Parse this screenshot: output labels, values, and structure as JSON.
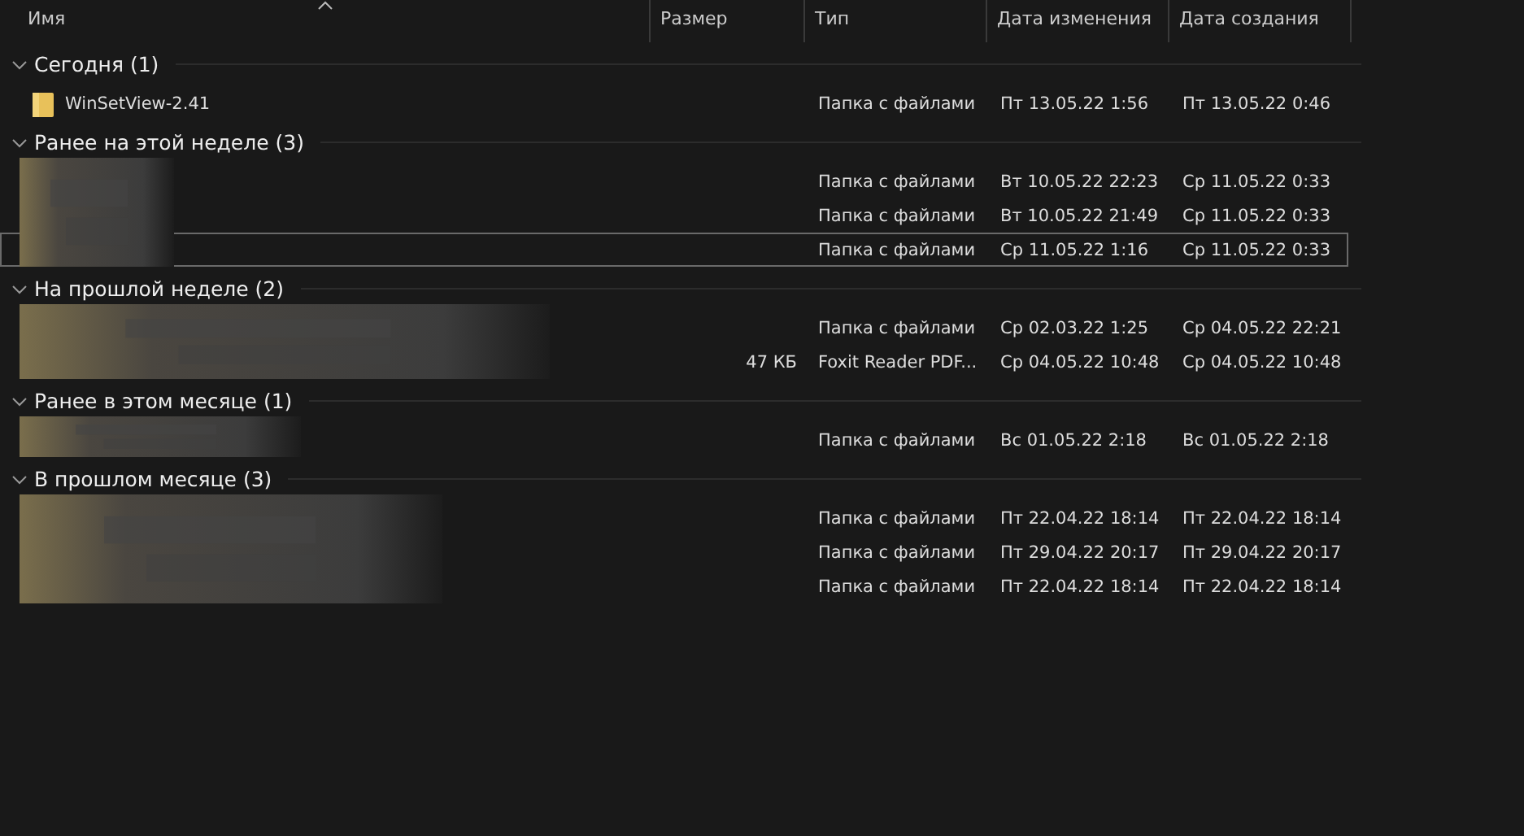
{
  "columns": [
    {
      "label": "Имя",
      "sorted": true
    },
    {
      "label": "Размер",
      "sorted": false
    },
    {
      "label": "Тип",
      "sorted": false
    },
    {
      "label": "Дата изменения",
      "sorted": false
    },
    {
      "label": "Дата создания",
      "sorted": false
    }
  ],
  "groups": [
    {
      "title": "Сегодня (1)",
      "expanded": true,
      "rows": [
        {
          "name": "WinSetView-2.41",
          "type": "Папка с файлами",
          "modified": "Пт 13.05.22 1:56",
          "created": "Пт 13.05.22 0:46",
          "selected": false
        }
      ]
    },
    {
      "title": "Ранее на этой неделе (3)",
      "expanded": true,
      "rows": [
        {
          "type": "Папка с файлами",
          "modified": "Вт 10.05.22 22:23",
          "created": "Ср 11.05.22 0:33",
          "selected": false
        },
        {
          "type": "Папка с файлами",
          "modified": "Вт 10.05.22 21:49",
          "created": "Ср 11.05.22 0:33",
          "selected": false
        },
        {
          "type": "Папка с файлами",
          "modified": "Ср 11.05.22 1:16",
          "created": "Ср 11.05.22 0:33",
          "selected": true
        }
      ]
    },
    {
      "title": "На прошлой неделе (2)",
      "expanded": true,
      "rows": [
        {
          "type": "Папка с файлами",
          "modified": "Ср 02.03.22 1:25",
          "created": "Ср 04.05.22 22:21",
          "selected": false
        },
        {
          "size": "47 КБ",
          "type": "Foxit Reader PDF...",
          "modified": "Ср 04.05.22 10:48",
          "created": "Ср 04.05.22 10:48",
          "selected": false
        }
      ]
    },
    {
      "title": "Ранее в этом месяце (1)",
      "expanded": true,
      "rows": [
        {
          "type": "Папка с файлами",
          "modified": "Вс 01.05.22 2:18",
          "created": "Вс 01.05.22 2:18",
          "selected": false
        }
      ]
    },
    {
      "title": "В прошлом месяце (3)",
      "expanded": true,
      "rows": [
        {
          "type": "Папка с файлами",
          "modified": "Пт 22.04.22 18:14",
          "created": "Пт 22.04.22 18:14",
          "selected": false
        },
        {
          "type": "Папка с файлами",
          "modified": "Пт 29.04.22 20:17",
          "created": "Пт 29.04.22 20:17",
          "selected": false
        },
        {
          "type": "Папка с файлами",
          "modified": "Пт 22.04.22 18:14",
          "created": "Пт 22.04.22 18:14",
          "selected": false
        }
      ]
    }
  ]
}
